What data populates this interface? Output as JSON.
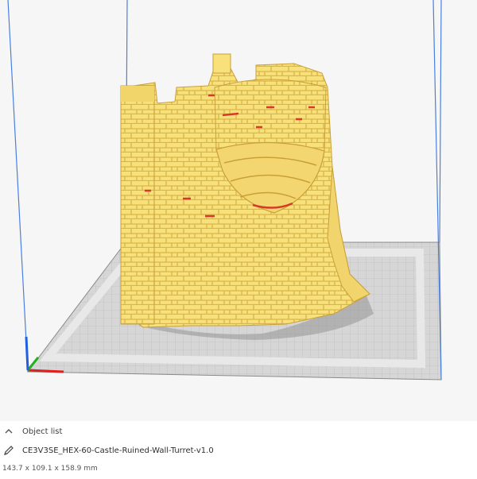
{
  "object_panel": {
    "header_label": "Object list",
    "object_name": "CE3V3SE_HEX-60-Castle-Ruined-Wall-Turret-v1.0",
    "dimensions": "143.7 x 109.1 x 158.9 mm"
  },
  "icons": {
    "expand": "chevron-up-icon",
    "rename": "pencil-icon",
    "axis_gizmo": "axis-gizmo-icon"
  },
  "colors": {
    "model": "#f8e07a",
    "model_shadow": "#dcb84c",
    "overhang": "#d63a2a",
    "build_volume_edge": "#4a7fe0",
    "build_plate": "#d8d8d8",
    "axis_x": "#e02020",
    "axis_y": "#20b020",
    "axis_z": "#2060e0"
  }
}
